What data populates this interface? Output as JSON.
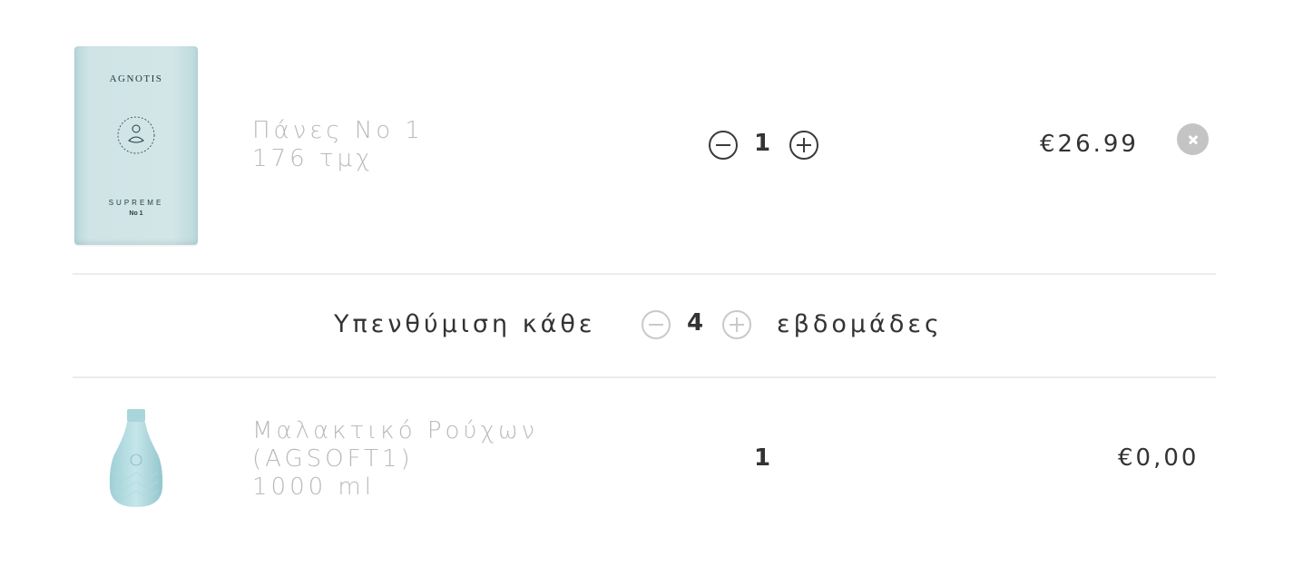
{
  "cart": {
    "items": [
      {
        "name_line1": "Πάνες No 1",
        "name_line2": "176 τμχ",
        "quantity": "1",
        "price": "€26.99",
        "image_icon": "diaper-pack-image",
        "image_brand": "AGNOTIS",
        "image_line": "SUPREME",
        "image_size": "No 1"
      },
      {
        "name_line1": "Μαλακτικό Ρούχων",
        "name_line2": "(AGSOFT1)",
        "name_line3": "1000 ml",
        "quantity": "1",
        "price": "€0,00",
        "image_icon": "softener-bottle-image"
      }
    ],
    "reminder": {
      "label": "Υπενθύμιση κάθε",
      "value": "4",
      "unit": "εβδομάδες"
    }
  },
  "colors": {
    "text": "#333333",
    "muted_text": "#b9b9b9",
    "divider": "#ececec",
    "product_teal": "#cfe4e6",
    "remove_bg": "#c4c4c4"
  }
}
